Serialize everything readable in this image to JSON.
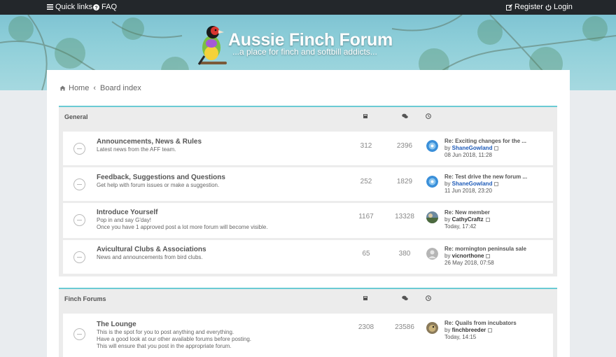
{
  "topbar": {
    "quick_links": "Quick links",
    "faq": "FAQ",
    "register": "Register",
    "login": "Login"
  },
  "brand": {
    "title": "Aussie Finch Forum",
    "tagline": "...a place for finch and softbill addicts..."
  },
  "breadcrumb": {
    "home": "Home",
    "board_index": "Board index"
  },
  "categories": [
    {
      "name": "General",
      "forums": [
        {
          "title": "Announcements, News & Rules",
          "desc": [
            "Latest news from the AFF team."
          ],
          "topics": "312",
          "posts": "2396",
          "last_title": "Re: Exciting changes for the ...",
          "last_user": "ShaneGowland",
          "last_user_style": "blue",
          "last_date": "08 Jun 2018, 11:28",
          "avatar": "globe"
        },
        {
          "title": "Feedback, Suggestions and Questions",
          "desc": [
            "Get help with forum issues or make a suggestion."
          ],
          "topics": "252",
          "posts": "1829",
          "last_title": "Re: Test drive the new forum ...",
          "last_user": "ShaneGowland",
          "last_user_style": "blue",
          "last_date": "11 Jun 2018, 23:20",
          "avatar": "globe"
        },
        {
          "title": "Introduce Yourself",
          "desc": [
            "Pop in and say G'day!",
            "Once you have 1 approved post a lot more forum will become visible."
          ],
          "topics": "1167",
          "posts": "13328",
          "last_title": "Re: New member",
          "last_user": "CathyCraftz",
          "last_user_style": "dark",
          "last_date": "Today, 17:42",
          "avatar": "photo"
        },
        {
          "title": "Avicultural Clubs & Associations",
          "desc": [
            "News and announcements from bird clubs."
          ],
          "topics": "65",
          "posts": "380",
          "last_title": "Re: mornington peninsula sale",
          "last_user": "vicnorthone",
          "last_user_style": "dark",
          "last_date": "26 May 2018, 07:58",
          "avatar": "grey"
        }
      ]
    },
    {
      "name": "Finch Forums",
      "forums": [
        {
          "title": "The Lounge",
          "desc": [
            "This is the spot for you to post anything and everything.",
            "Have a good look at our other available forums before posting.",
            "This will ensure that you post in the appropriate forum."
          ],
          "topics": "2308",
          "posts": "23586",
          "last_title": "Re: Quails from incubators",
          "last_user": "finchbreeder",
          "last_user_style": "dark",
          "last_date": "Today, 14:15",
          "avatar": "bird"
        }
      ]
    }
  ],
  "colors": {
    "accent": "#6bcbd4",
    "topbar": "#23272b",
    "link_blue": "#1e5bb8"
  },
  "icons": {
    "topics": "book-icon",
    "posts": "comments-icon",
    "last_post": "clock-icon"
  }
}
